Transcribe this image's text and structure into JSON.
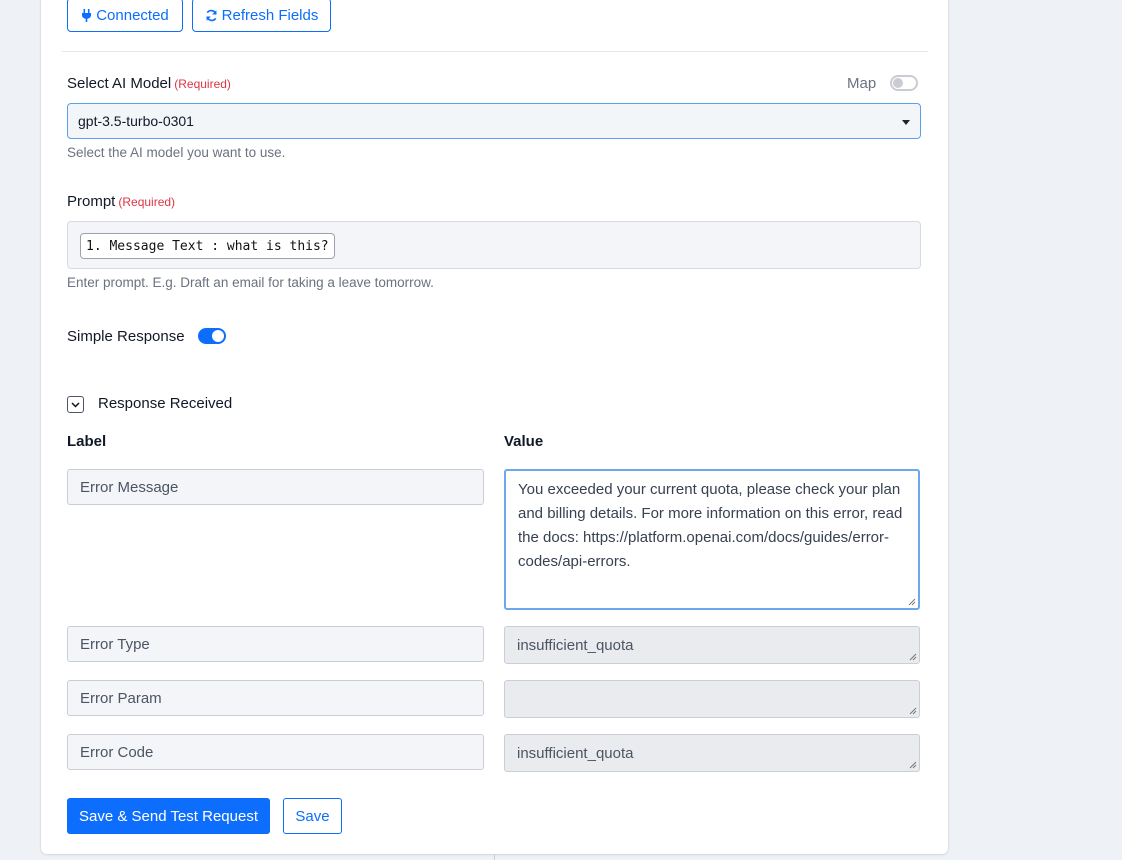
{
  "toolbar": {
    "connected_label": "Connected",
    "connected_icon": "plug-icon",
    "refresh_label": "Refresh Fields",
    "refresh_icon": "refresh-icon"
  },
  "model": {
    "label": "Select AI Model",
    "required": "(Required)",
    "map_label": "Map",
    "map_enabled": false,
    "selected": "gpt-3.5-turbo-0301",
    "help": "Select the AI model you want to use."
  },
  "prompt": {
    "label": "Prompt",
    "required": "(Required)",
    "chip": "1. Message Text : what is this?",
    "help": "Enter prompt. E.g. Draft an email for taking a leave tomorrow."
  },
  "simple_response": {
    "label": "Simple Response",
    "enabled": true
  },
  "response": {
    "title": "Response Received",
    "label_header": "Label",
    "value_header": "Value",
    "rows": [
      {
        "label": "Error Message",
        "value": "You exceeded your current quota, please check your plan and billing details. For more information on this error, read the docs: https://platform.openai.com/docs/guides/error-codes/api-errors."
      },
      {
        "label": "Error Type",
        "value": "insufficient_quota"
      },
      {
        "label": "Error Param",
        "value": ""
      },
      {
        "label": "Error Code",
        "value": "insufficient_quota"
      }
    ]
  },
  "actions": {
    "save_send_label": "Save & Send Test Request",
    "save_label": "Save"
  },
  "colors": {
    "primary": "#0d6efd",
    "required": "#dc3545"
  }
}
